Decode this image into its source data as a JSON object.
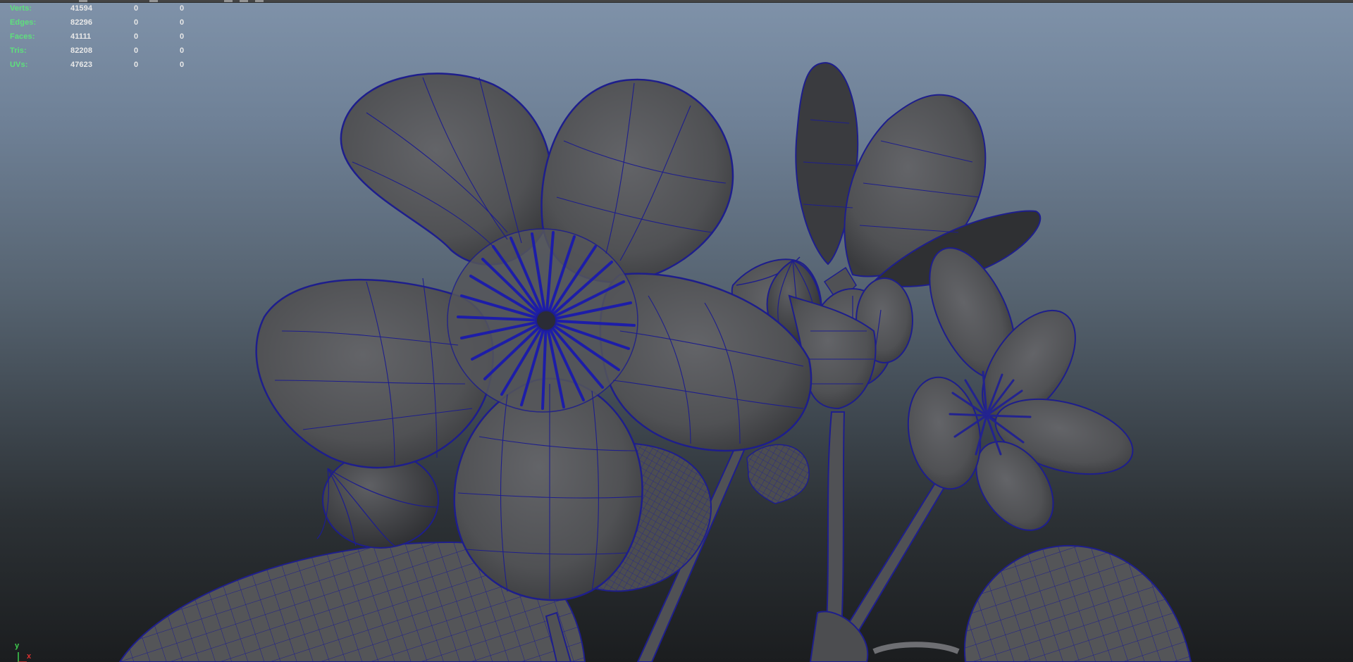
{
  "hud": {
    "rows": [
      {
        "label": "Verts:",
        "v1": "41594",
        "v2": "0",
        "v3": "0"
      },
      {
        "label": "Edges:",
        "v1": "82296",
        "v2": "0",
        "v3": "0"
      },
      {
        "label": "Faces:",
        "v1": "41111",
        "v2": "0",
        "v3": "0"
      },
      {
        "label": "Tris:",
        "v1": "82208",
        "v2": "0",
        "v3": "0"
      },
      {
        "label": "UVs:",
        "v1": "47623",
        "v2": "0",
        "v3": "0"
      }
    ]
  },
  "axis": {
    "y_label": "y",
    "x_label": "x",
    "y_color": "#3fd04f",
    "x_color": "#e03030"
  },
  "colors": {
    "wire": "#1e1e8c",
    "surface": "#555659",
    "surface_dark": "#333538"
  }
}
